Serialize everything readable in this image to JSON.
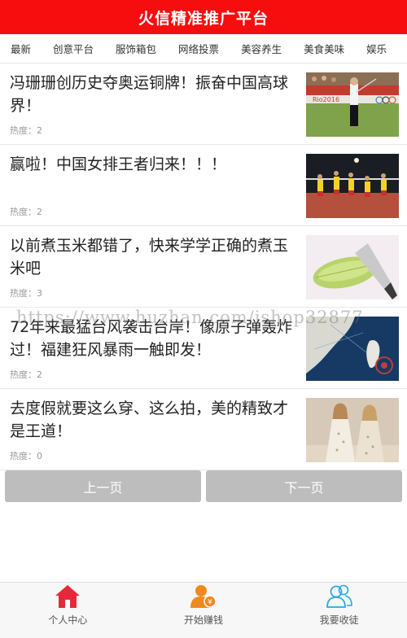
{
  "header": {
    "title": "火信精准推广平台"
  },
  "tabs": [
    "最新",
    "创意平台",
    "服饰箱包",
    "网络投票",
    "美容养生",
    "美食美味",
    "娱乐"
  ],
  "heat_label": "热度：",
  "articles": [
    {
      "title": "冯珊珊创历史夺奥运铜牌！振奋中国高球界！",
      "heat": "2",
      "image": "golf-player-photo"
    },
    {
      "title": "赢啦！中国女排王者归来！！！",
      "heat": "2",
      "image": "volleyball-team-photo"
    },
    {
      "title": "以前煮玉米都错了，快来学学正确的煮玉米吧",
      "heat": "3",
      "image": "corn-cutting-photo"
    },
    {
      "title": "72年来最猛台风袭击台岸！像原子弹轰炸过！福建狂风暴雨一触即发！",
      "heat": "2",
      "image": "typhoon-satellite-map"
    },
    {
      "title": "去度假就要这么穿、这么拍，美的精致才是王道！",
      "heat": "0",
      "image": "fashion-models-photo"
    }
  ],
  "pager": {
    "prev": "上一页",
    "next": "下一页"
  },
  "watermark": "https://www.huzhan.com/ishop32877",
  "footer": [
    {
      "label": "个人中心",
      "icon": "home-icon",
      "color": "#e8283a"
    },
    {
      "label": "开始赚钱",
      "icon": "earn-money-user-icon",
      "color": "#f08a1c"
    },
    {
      "label": "我要收徒",
      "icon": "recruit-users-icon",
      "color": "#2aa7e0"
    }
  ]
}
